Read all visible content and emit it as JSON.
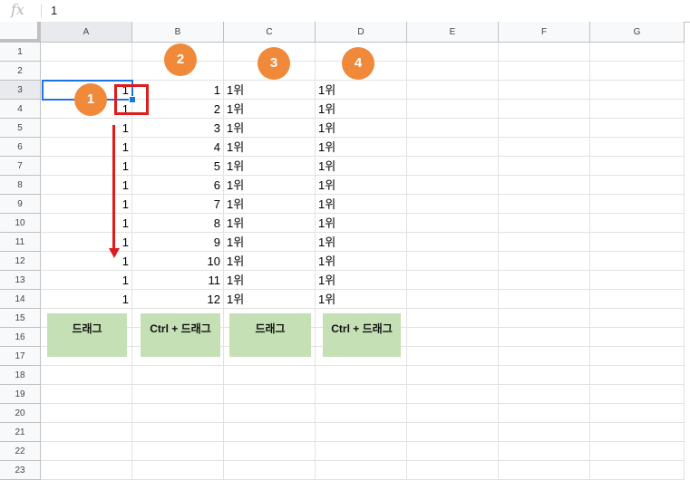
{
  "formula_bar": {
    "icon": "fx-icon",
    "value": "1"
  },
  "columns": [
    "A",
    "B",
    "C",
    "D",
    "E",
    "F",
    "G"
  ],
  "rows": [
    "1",
    "2",
    "3",
    "4",
    "5",
    "6",
    "7",
    "8",
    "9",
    "10",
    "11",
    "12",
    "13",
    "14",
    "15",
    "16",
    "17",
    "18",
    "19",
    "20",
    "21",
    "22",
    "23"
  ],
  "active_cell": "A3",
  "active_column": "A",
  "active_row": "3",
  "cells": {
    "A": [
      "1",
      "1",
      "1",
      "1",
      "1",
      "1",
      "1",
      "1",
      "1",
      "1",
      "1",
      "1"
    ],
    "B": [
      "1",
      "2",
      "3",
      "4",
      "5",
      "6",
      "7",
      "8",
      "9",
      "10",
      "11",
      "12"
    ],
    "C": [
      "1위",
      "1위",
      "1위",
      "1위",
      "1위",
      "1위",
      "1위",
      "1위",
      "1위",
      "1위",
      "1위",
      "1위"
    ],
    "D": [
      "1위",
      "1위",
      "1위",
      "1위",
      "1위",
      "1위",
      "1위",
      "1위",
      "1위",
      "1위",
      "1위",
      "1위"
    ]
  },
  "badges": [
    "1",
    "2",
    "3",
    "4"
  ],
  "action_cards": {
    "a": "드래그",
    "b": "Ctrl + 드래그",
    "c": "드래그",
    "d": "Ctrl + 드래그"
  },
  "colors": {
    "badge": "#f08a3a",
    "highlight_box": "#e01b1b",
    "selection": "#1a73e8",
    "card_fill": "#c5e0b4"
  }
}
